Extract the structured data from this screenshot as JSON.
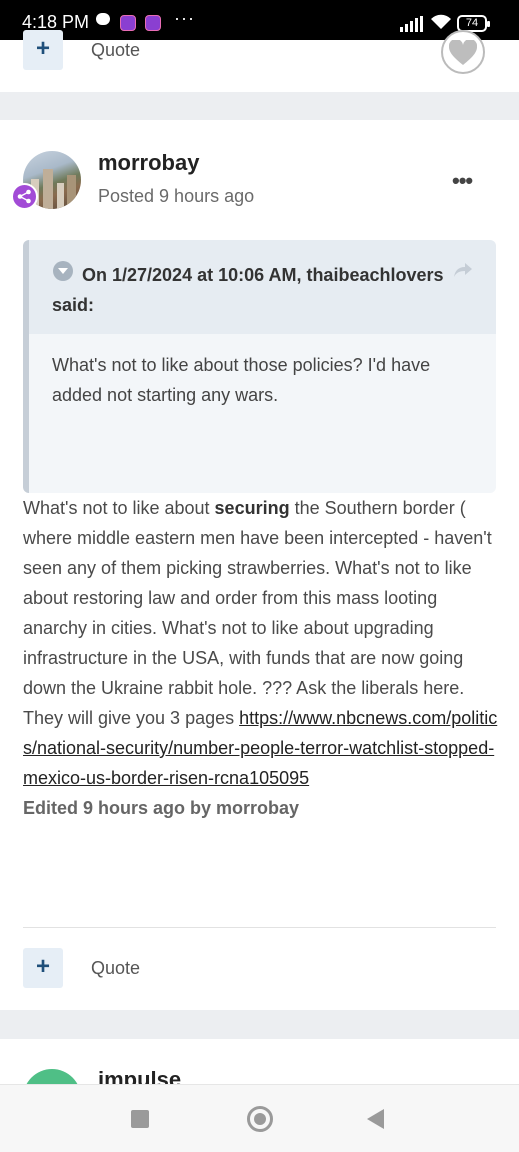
{
  "status_bar": {
    "time": "4:18 PM",
    "more": "···",
    "battery": "74"
  },
  "top_card": {
    "quote_label": "Quote"
  },
  "post": {
    "author": "morrobay",
    "posted": "Posted 9 hours ago",
    "menu": "•••",
    "quote": {
      "attribution": "On 1/27/2024 at 10:06 AM, thaibeachlovers said:",
      "text": "What's not to like about those policies? I'd have added not starting any wars."
    },
    "body": {
      "part1": "What's not to like about ",
      "bold": "securing",
      "part2": " the Southern border ( where middle eastern men have been intercepted - haven't seen any of them picking strawberries. What's not to like about restoring law and order from this mass looting anarchy in cities. What's not to like about upgrading infrastructure in the USA, with funds that are now going down the Ukraine rabbit hole. ???  Ask the liberals here. They will give you 3 pages ",
      "link": "https://www.nbcnews.com/politics/national-security/number-people-terror-watchlist-stopped-mexico-us-border-risen-rcna105095",
      "edited": "Edited 9 hours ago by morrobay"
    },
    "plus_label": "+",
    "quote_label": "Quote"
  },
  "next_post": {
    "author": "impulse"
  },
  "icons": [
    "chat-bubble-icon",
    "app-badge-icon",
    "signal-icon",
    "wifi-icon",
    "battery-icon",
    "plus-icon",
    "heart-icon",
    "share-icon",
    "collapse-icon",
    "rank-badge-icon",
    "recents-icon",
    "home-icon",
    "back-icon"
  ],
  "colors": {
    "accent_plus_bg": "#e6eef6",
    "accent_plus_fg": "#1f4f7a",
    "rank_badge": "#a24bd6",
    "separator": "#eceef1"
  }
}
